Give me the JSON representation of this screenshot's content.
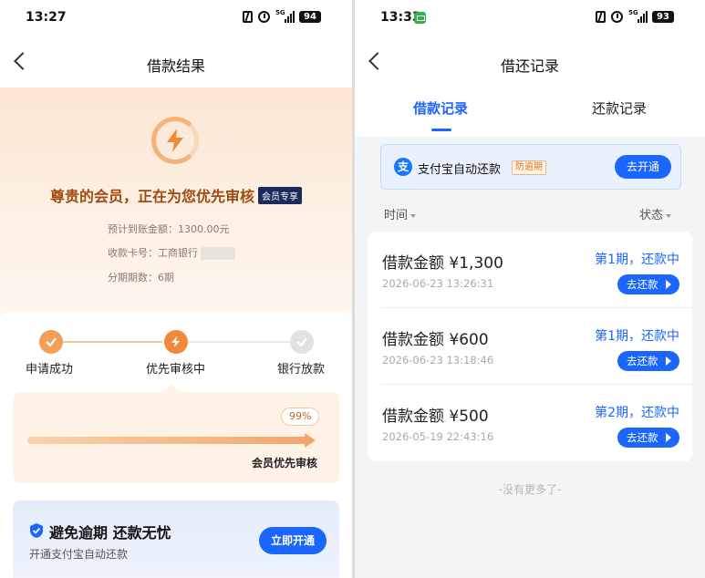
{
  "left": {
    "status": {
      "time": "13:27",
      "net": "5G",
      "battery": "94"
    },
    "nav": {
      "title": "借款结果"
    },
    "hero": {
      "title": "尊贵的会员，正在为您优先审核",
      "badge": "会员专享",
      "amount_line": "预计到账金额：1300.00元",
      "card_line": "收款卡号：工商银行",
      "period_line": "分期期数：6期"
    },
    "steps": [
      {
        "label": "申请成功",
        "state": "done"
      },
      {
        "label": "优先审核中",
        "state": "current"
      },
      {
        "label": "银行放款",
        "state": "pending"
      }
    ],
    "review": {
      "percent": 99,
      "percent_label": "99%",
      "label": "会员优先审核"
    },
    "promo": {
      "title": "避免逾期 还款无忧",
      "subtitle": "开通支付宝自动还款",
      "button": "立即开通"
    }
  },
  "right": {
    "status": {
      "time": "13:33",
      "net": "5G",
      "battery": "93"
    },
    "nav": {
      "title": "借还记录"
    },
    "tabs": [
      {
        "label": "借款记录",
        "active": true
      },
      {
        "label": "还款记录",
        "active": false
      }
    ],
    "alipay": {
      "icon_char": "支",
      "text": "支付宝自动还款",
      "badge": "防逾期",
      "button": "去开通"
    },
    "list_head": {
      "time": "时间",
      "status": "状态"
    },
    "records": [
      {
        "amount": "借款金额 ¥1,300",
        "time": "2026-06-23 13:26:31",
        "status": "第1期，还款中",
        "button": "去还款"
      },
      {
        "amount": "借款金额 ¥600",
        "time": "2026-06-23 13:18:46",
        "status": "第1期，还款中",
        "button": "去还款"
      },
      {
        "amount": "借款金额 ¥500",
        "time": "2026-05-19 22:43:16",
        "status": "第2期，还款中",
        "button": "去还款"
      }
    ],
    "footer": "-没有更多了-"
  },
  "colors": {
    "brand_blue": "#1a66ff",
    "accent_orange": "#f08a3a",
    "hero_title": "#a04a12"
  }
}
